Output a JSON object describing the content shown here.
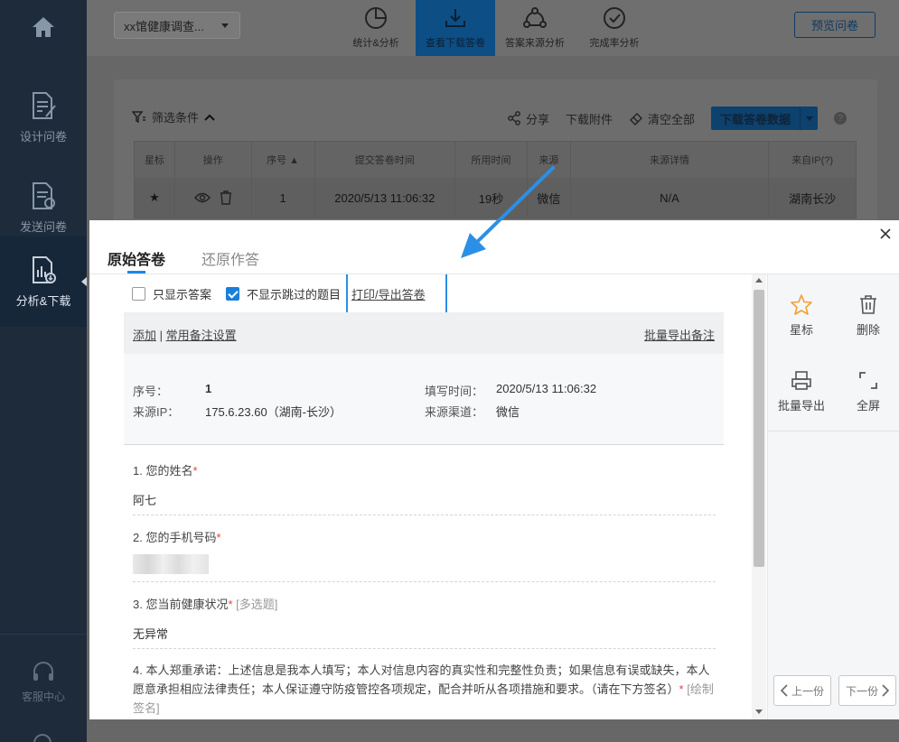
{
  "sidebar": {
    "items": [
      {
        "label": "设计问卷",
        "icon": "design-survey-icon"
      },
      {
        "label": "发送问卷",
        "icon": "send-survey-icon"
      },
      {
        "label": "分析&下载",
        "icon": "analyze-download-icon"
      }
    ],
    "support": "客服中心"
  },
  "topbar": {
    "survey_name": "xx馆健康调查...",
    "tabs": [
      {
        "label": "统计&分析",
        "icon": "pie-chart-icon"
      },
      {
        "label": "查看下载答卷",
        "icon": "download-icon"
      },
      {
        "label": "答案来源分析",
        "icon": "share-nodes-icon"
      },
      {
        "label": "完成率分析",
        "icon": "check-circle-icon"
      }
    ],
    "preview_label": "预览问卷"
  },
  "toolbar": {
    "filter_label": "筛选条件",
    "share_label": "分享",
    "download_attachments": "下载附件",
    "clear_all": "清空全部",
    "download_data": "下载答卷数据",
    "help": "?"
  },
  "table": {
    "headers": [
      "星标",
      "操作",
      "序号 ▲",
      "提交答卷时间",
      "所用时间",
      "来源",
      "来源详情",
      "来自IP(?)"
    ],
    "rows": [
      {
        "seq": "1",
        "submit_time": "2020/5/13 11:06:32",
        "duration": "19秒",
        "source": "微信",
        "source_detail": "N/A",
        "ip_from": "湖南长沙"
      }
    ]
  },
  "modal": {
    "tabs": {
      "original": "原始答卷",
      "restore": "还原作答"
    },
    "options": {
      "only_answers": "只显示答案",
      "hide_skipped": "不显示跳过的题目",
      "print_export": "打印/导出答卷"
    },
    "note_bar": {
      "add": "添加",
      "divider": "|",
      "common_settings": "常用备注设置",
      "batch_export_notes": "批量导出备注"
    },
    "info": {
      "seq_label": "序号：",
      "seq_value": "1",
      "fill_time_label": "填写时间：",
      "fill_time_value": "2020/5/13 11:06:32",
      "ip_label": "来源IP：",
      "ip_value": "175.6.23.60（湖南-长沙）",
      "channel_label": "来源渠道：",
      "channel_value": "微信"
    },
    "questions": [
      {
        "title": "1. 您的姓名",
        "required": "*",
        "hint": "",
        "answer": "阿七"
      },
      {
        "title": "2. 您的手机号码",
        "required": "*",
        "hint": "",
        "answer": ""
      },
      {
        "title": "3. 您当前健康状况",
        "required": "*",
        "hint": "[多选题]",
        "answer": "无异常"
      },
      {
        "title": "4. 本人郑重承诺：上述信息是我本人填写；本人对信息内容的真实性和完整性负责；如果信息有误或缺失，本人愿意承担相应法律责任；本人保证遵守防疫管控各项规定，配合并听从各项措施和要求。（请在下方签名）",
        "required": "*",
        "hint": "[绘制签名]",
        "answer": ""
      }
    ],
    "side": {
      "star": "星标",
      "delete": "删除",
      "batch_export": "批量导出",
      "fullscreen": "全屏",
      "prev": "上一份",
      "next": "下一份"
    }
  }
}
